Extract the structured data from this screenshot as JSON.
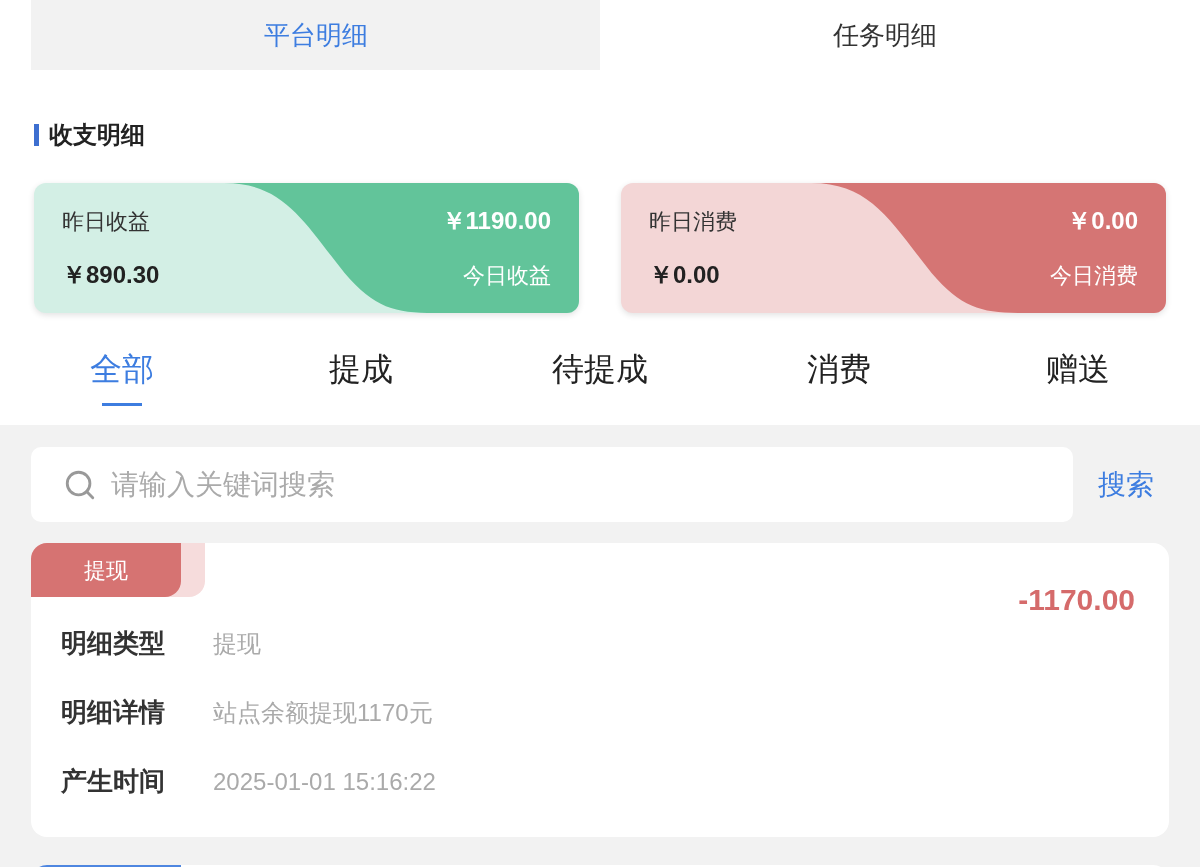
{
  "top_tabs": [
    {
      "label": "平台明细",
      "selected": true
    },
    {
      "label": "任务明细",
      "selected": false
    }
  ],
  "section_title": "收支明细",
  "summary_cards": [
    {
      "kind": "income",
      "label": "昨日收益",
      "value": "￥890.30",
      "today_amount": "￥1190.00",
      "today_label": "今日收益"
    },
    {
      "kind": "expense",
      "label": "昨日消费",
      "value": "￥0.00",
      "today_amount": "￥0.00",
      "today_label": "今日消费"
    }
  ],
  "filter_tabs": [
    {
      "label": "全部",
      "selected": true
    },
    {
      "label": "提成",
      "selected": false
    },
    {
      "label": "待提成",
      "selected": false
    },
    {
      "label": "消费",
      "selected": false
    },
    {
      "label": "赠送",
      "selected": false
    }
  ],
  "search": {
    "placeholder": "请输入关键词搜索",
    "button": "搜索"
  },
  "records": [
    {
      "tag": "提现",
      "kind": "withdraw",
      "amount": "-1170.00",
      "fields": [
        {
          "label": "明细类型",
          "value": "提现"
        },
        {
          "label": "明细详情",
          "value": "站点余额提现1170元"
        },
        {
          "label": "产生时间",
          "value": "2025-01-01 15:16:22"
        }
      ]
    }
  ]
}
